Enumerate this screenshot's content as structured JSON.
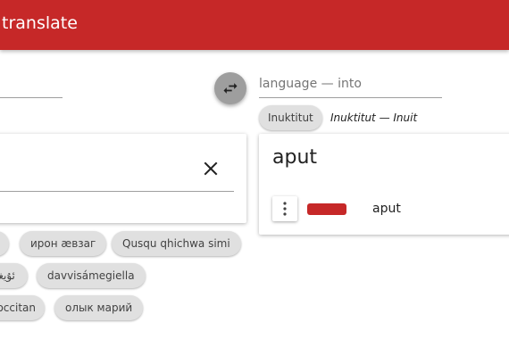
{
  "app": {
    "title": "translate"
  },
  "swap": {
    "icon": "swap-horiz-icon"
  },
  "target": {
    "placeholder": "language — into",
    "selected_chip": "Inuktitut",
    "selected_description": "Inuktitut — Inuit"
  },
  "input": {
    "clear_icon": "close-icon"
  },
  "output": {
    "word": "aput",
    "result": {
      "menu_icon": "more-vert-icon",
      "color": "#c62828",
      "text": "aput"
    }
  },
  "language_chips": [
    "ирон æвзаг",
    "Qusqu qhichwa simi",
    "ئۇيغۇ",
    "davvisámegiella",
    "occitan",
    "олык марий"
  ],
  "colors": {
    "accent": "#c62828",
    "chip_bg": "#e0e0e0"
  }
}
